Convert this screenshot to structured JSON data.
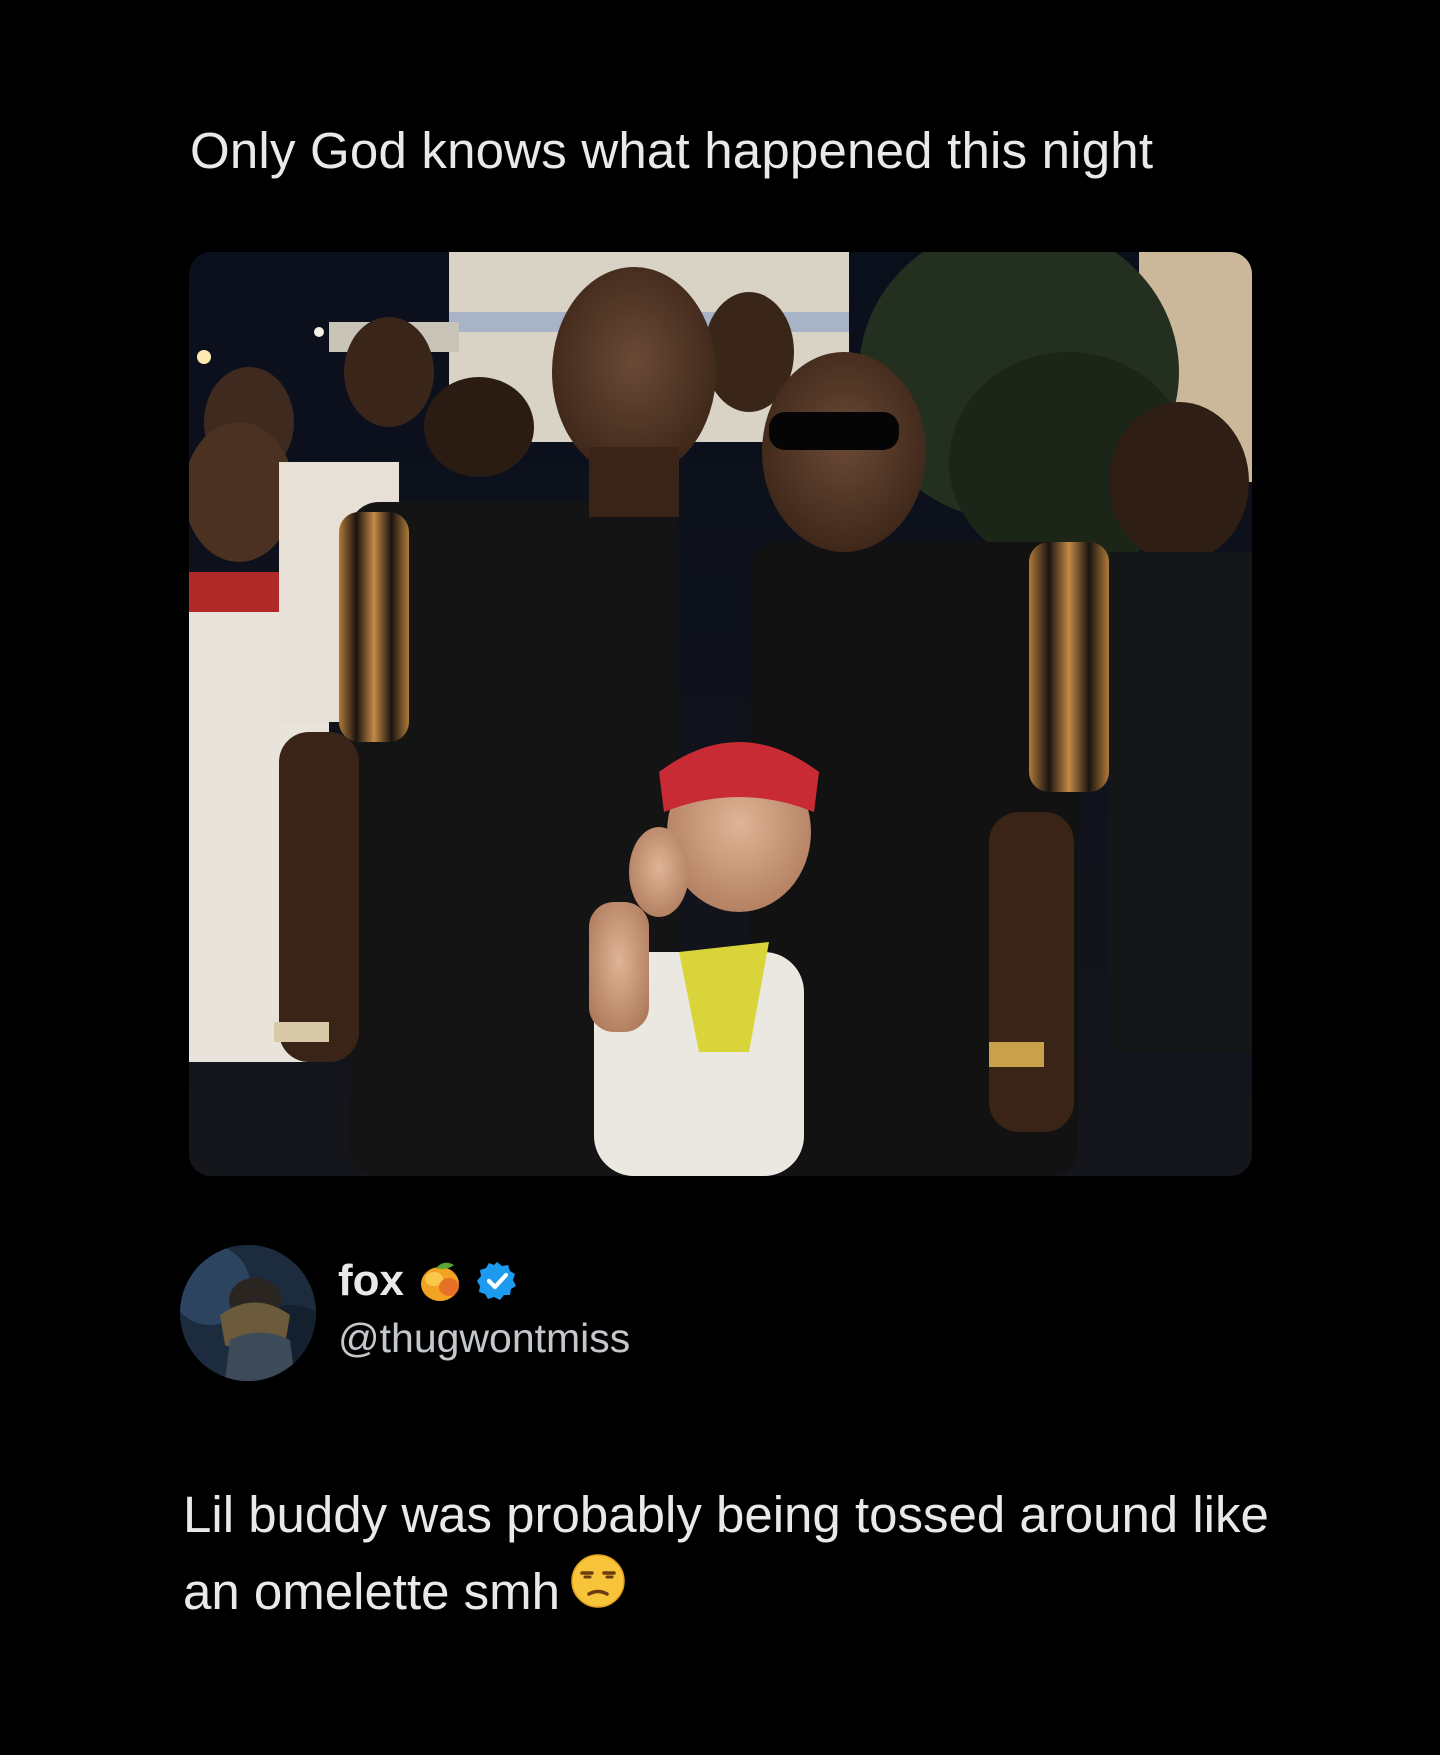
{
  "quote": {
    "text": "Only God knows what happened this night"
  },
  "media": {
    "icon": "photo-image",
    "bg_color": "#0b0b0d"
  },
  "author": {
    "display_name": "fox",
    "handle": "@thugwontmiss",
    "name_emoji_icon": "mango-icon",
    "verified_icon": "verified-badge-icon",
    "verified_color": "#1d9bf0"
  },
  "reply": {
    "text": "Lil buddy was probably being tossed around like an omelette smh",
    "emoji_icon": "unamused-face-icon"
  }
}
